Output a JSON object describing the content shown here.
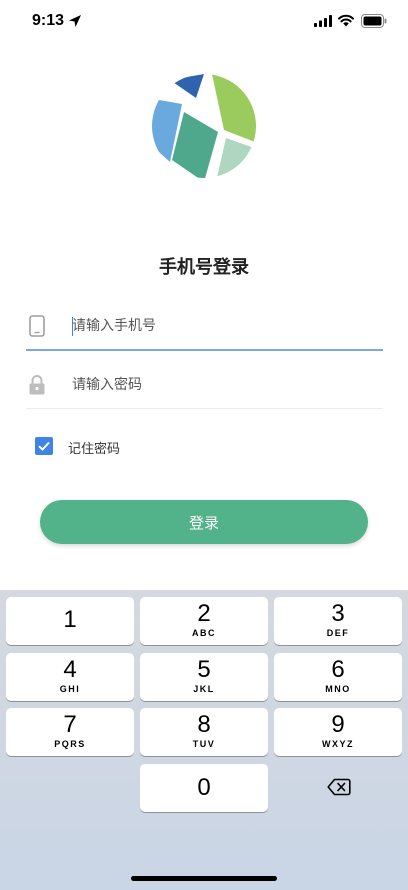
{
  "status_bar": {
    "time": "9:13"
  },
  "login": {
    "title": "手机号登录",
    "phone_placeholder": "请输入手机号",
    "password_placeholder": "请输入密码",
    "remember_label": "记住密码",
    "remember_checked": true,
    "login_button": "登录"
  },
  "keyboard": {
    "keys": [
      {
        "num": "1",
        "letters": ""
      },
      {
        "num": "2",
        "letters": "ABC"
      },
      {
        "num": "3",
        "letters": "DEF"
      },
      {
        "num": "4",
        "letters": "GHI"
      },
      {
        "num": "5",
        "letters": "JKL"
      },
      {
        "num": "6",
        "letters": "MNO"
      },
      {
        "num": "7",
        "letters": "PQRS"
      },
      {
        "num": "8",
        "letters": "TUV"
      },
      {
        "num": "9",
        "letters": "WXYZ"
      },
      {
        "num": "0",
        "letters": ""
      }
    ],
    "delete_icon": "delete-backspace-icon"
  },
  "colors": {
    "accent": "#3f83e6",
    "button": "#52b28a",
    "logo_blue": "#6aa9de",
    "logo_green": "#9ccb5d",
    "logo_teal": "#4fa88b"
  }
}
